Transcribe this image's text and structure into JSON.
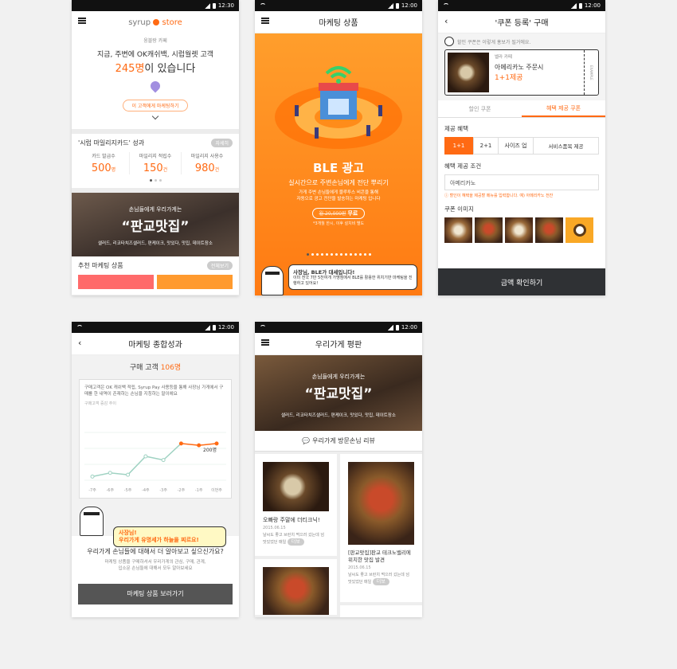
{
  "screen1": {
    "status_time": "12:30",
    "logo_text": "syrup",
    "logo_store": "store",
    "shop_name": "웅블랑 카페",
    "headline_line1": "지금, 주변에 OK캐쉬백, 시럽월렛 고객",
    "headline_count": "245명",
    "headline_suffix": "이 있습니다",
    "market_button": "이 고객에게 마케팅하기",
    "card_title": "'시럽 마일리지카드' 성과",
    "card_badge": "자세히",
    "stats": [
      {
        "label": "카드 발급수",
        "value": "500",
        "unit": "명"
      },
      {
        "label": "마일리지 적립수",
        "value": "150",
        "unit": "건"
      },
      {
        "label": "마일리지 사용수",
        "value": "980",
        "unit": "건"
      }
    ],
    "banner_sub": "손님들에게 우리가게는",
    "banner_title": "“판교맛집”",
    "banner_tags": "샐러드, 리코타치즈샐러드, 편케이크, 맛있다, 맛집, 데이트장소",
    "rec_title": "추천 마케팅 상품",
    "rec_badge": "전체보기"
  },
  "screen2": {
    "status_time": "12:00",
    "title": "마케팅 상품",
    "ble_title": "BLE 광고",
    "ble_sub": "실시간으로 주변손님에게 전단 뿌리기",
    "ble_desc1": "가게 주변 손님들에게 블루투스 비콘을 통해",
    "ble_desc2": "자동으로 광고 전단을 발송하는 마케팅 입니다",
    "price_old": "월 20,000원",
    "price_free": "무료",
    "price_note": "*3개월 한시, 이후 설치비 별도",
    "bubble_title": "사장님, BLE가 대세입니다!",
    "bubble_text": "이미 전국 7만 5천여개 가맹점에서 BLE를 활용한 위치기반 마케팅을 진행하고 있어요!"
  },
  "screen3": {
    "status_time": "12:00",
    "title": "'쿠폰 등록' 구매",
    "hint": "할인 쿠폰은 이렇게 홍보가 될거에요.",
    "coupon_shop": "벨라 카페",
    "coupon_item": "아메리카노 주문시",
    "coupon_offer": "1+1제공",
    "coupon_stub": "EXAMPLE",
    "tab_discount": "할인 쿠폰",
    "tab_benefit": "혜택 제공 쿠폰",
    "benefit_label": "제공 혜택",
    "options": [
      "1+1",
      "2+1",
      "사이즈 업",
      "서비스품목 제공"
    ],
    "condition_label": "혜택 제공 조건",
    "condition_value": "아메리카노",
    "condition_note": "할인이 혜택을 제공할 메뉴를 입력합니다. 예) 아메리카노 전잔",
    "image_label": "쿠폰 이미지",
    "confirm": "금액 확인하기"
  },
  "screen4": {
    "status_time": "12:00",
    "title": "마케팅 종합성과",
    "buyers_label": "구매 고객",
    "buyers_count": "106명",
    "desc": "구매고객은 OK 캐쉬백 적립, Syrup Pay 사용등을 통해 사장님 가게에서 구매를 한 내역이 존재하는 손님을 지칭하는 말이에요",
    "chart_caption": "구매고객 증감 추이",
    "bubble1": "사장님!",
    "bubble2": "우리가게 유명세가 하늘을 찌르요!",
    "question": "우리가게 손님들에 대해서 더 알아보고 싶으신가요?",
    "sub1": "마케팅 상품을 구매하셔서 우리가게의 관심, 구매, 관계,",
    "sub2": "입소문 손님들에 대해서 모두 알아보세요",
    "cta": "마케팅 상품 보러가기"
  },
  "chart_data": {
    "type": "line",
    "title": "구매고객 증감 추이",
    "categories": [
      "-7주",
      "-6주",
      "-5주",
      "-4주",
      "-3주",
      "-2주",
      "-1주",
      "이번주"
    ],
    "values": [
      20,
      40,
      30,
      130,
      110,
      200,
      190,
      200
    ],
    "end_label": "200명",
    "ylim": [
      0,
      260
    ],
    "colors": {
      "line": "#9fd2c2",
      "highlight": "#ff6a13"
    }
  },
  "screen5": {
    "status_time": "12:00",
    "title": "우리가게 평판",
    "banner_sub": "손님들에게 우리가게는",
    "banner_title": "“판교맛집”",
    "banner_tags": "샐러드, 리코타치즈샐러드, 편케이크, 맛있다, 맛집, 데이트장소",
    "review_title": "우리가게 방문손님 리뷰",
    "reviews": [
      {
        "title": "오빠랑 주말에 더티크닉!",
        "date": "2015.06.15",
        "text": "날씨도 좋고 브런치 먹으러 갔는데 넘 맛있었던 매일",
        "badge": "더보"
      },
      {
        "title": "[판교맛집]판교 테크노밸리에 위치한 맛집 발견",
        "date": "2015.06.15",
        "text": "날씨도 좋고 브런치 먹으러 갔는데 넘 맛있었던 매일",
        "badge": "더보"
      }
    ]
  }
}
